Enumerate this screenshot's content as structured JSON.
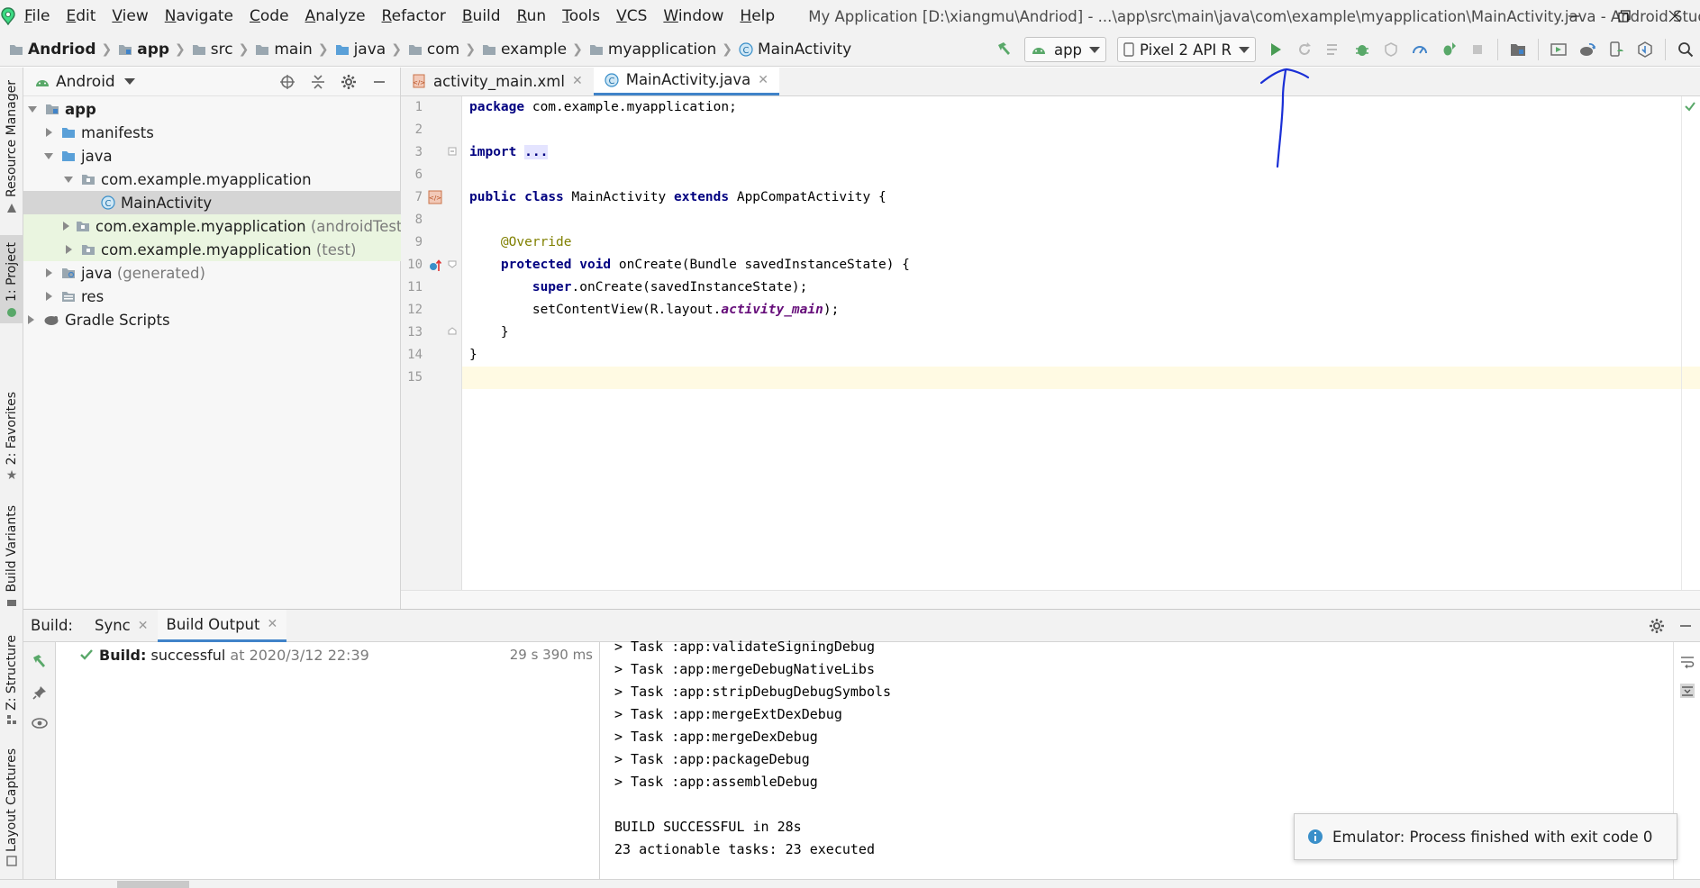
{
  "menu": {
    "items": [
      "File",
      "Edit",
      "View",
      "Navigate",
      "Code",
      "Analyze",
      "Refactor",
      "Build",
      "Run",
      "Tools",
      "VCS",
      "Window",
      "Help"
    ],
    "window_title": "My Application [D:\\xiangmu\\Andriod] - ...\\app\\src\\main\\java\\com\\example\\myapplication\\MainActivity.java - Android Studio"
  },
  "breadcrumb": [
    "Andriod",
    "app",
    "src",
    "main",
    "java",
    "com",
    "example",
    "myapplication",
    "MainActivity"
  ],
  "toolbar": {
    "run_config": "app",
    "device": "Pixel 2 API R",
    "run_icon": "run-icon",
    "run_color": "#499c54"
  },
  "left_stripe": {
    "resource_manager": "Resource Manager",
    "project": "1: Project",
    "favorites": "2: Favorites",
    "build_variants": "Build Variants",
    "structure": "Z: Structure",
    "layout_captures": "Layout Captures"
  },
  "project": {
    "view_selector": "Android",
    "tree": [
      {
        "label": "app",
        "suffix": ""
      },
      {
        "label": "manifests",
        "suffix": ""
      },
      {
        "label": "java",
        "suffix": ""
      },
      {
        "label": "com.example.myapplication",
        "suffix": ""
      },
      {
        "label": "MainActivity",
        "suffix": ""
      },
      {
        "label": "com.example.myapplication",
        "suffix": "(androidTest)"
      },
      {
        "label": "com.example.myapplication",
        "suffix": "(test)"
      },
      {
        "label": "java",
        "suffix": "(generated)"
      },
      {
        "label": "res",
        "suffix": ""
      },
      {
        "label": "Gradle Scripts",
        "suffix": ""
      }
    ]
  },
  "editor": {
    "tabs": [
      {
        "label": "activity_main.xml",
        "active": false
      },
      {
        "label": "MainActivity.java",
        "active": true
      }
    ],
    "line_numbers": [
      "1",
      "2",
      "3",
      "6",
      "7",
      "8",
      "9",
      "10",
      "11",
      "12",
      "13",
      "14",
      "15"
    ],
    "code": {
      "l1_kw": "package",
      "l1_rest": " com.example.myapplication;",
      "l3_kw": "import",
      "l3_fold": "...",
      "l7_kw1": "public",
      "l7_kw2": "class",
      "l7_name": " MainActivity ",
      "l7_kw3": "extends",
      "l7_rest": " AppCompatActivity {",
      "l9_ann": "@Override",
      "l10_kw1": "protected",
      "l10_kw2": "void",
      "l10_rest": " onCreate(Bundle savedInstanceState) {",
      "l11_kw": "super",
      "l11_rest": ".onCreate(savedInstanceState);",
      "l12_pre": "setContentView(R.layout.",
      "l12_ital": "activity_main",
      "l12_post": ");",
      "l13": "}",
      "l14": "}"
    }
  },
  "build": {
    "title": "Build:",
    "tabs": [
      {
        "label": "Sync",
        "active": false
      },
      {
        "label": "Build Output",
        "active": true
      }
    ],
    "status_label": "Build:",
    "status_value": "successful",
    "status_at": "at 2020/3/12 22:39",
    "duration": "29 s 390 ms",
    "console": [
      "> Task :app:validateSigningDebug",
      "> Task :app:mergeDebugNativeLibs",
      "> Task :app:stripDebugDebugSymbols",
      "> Task :app:mergeExtDexDebug",
      "> Task :app:mergeDexDebug",
      "> Task :app:packageDebug",
      "> Task :app:assembleDebug",
      "",
      "BUILD SUCCESSFUL in 28s",
      "23 actionable tasks: 23 executed"
    ]
  },
  "notification": {
    "text": "Emulator: Process finished with exit code 0"
  },
  "colors": {
    "accent": "#4083c9",
    "success": "#59a869",
    "keyword": "#000080",
    "annotation": "#808000",
    "ink_annotation": "#1a2fd6"
  }
}
